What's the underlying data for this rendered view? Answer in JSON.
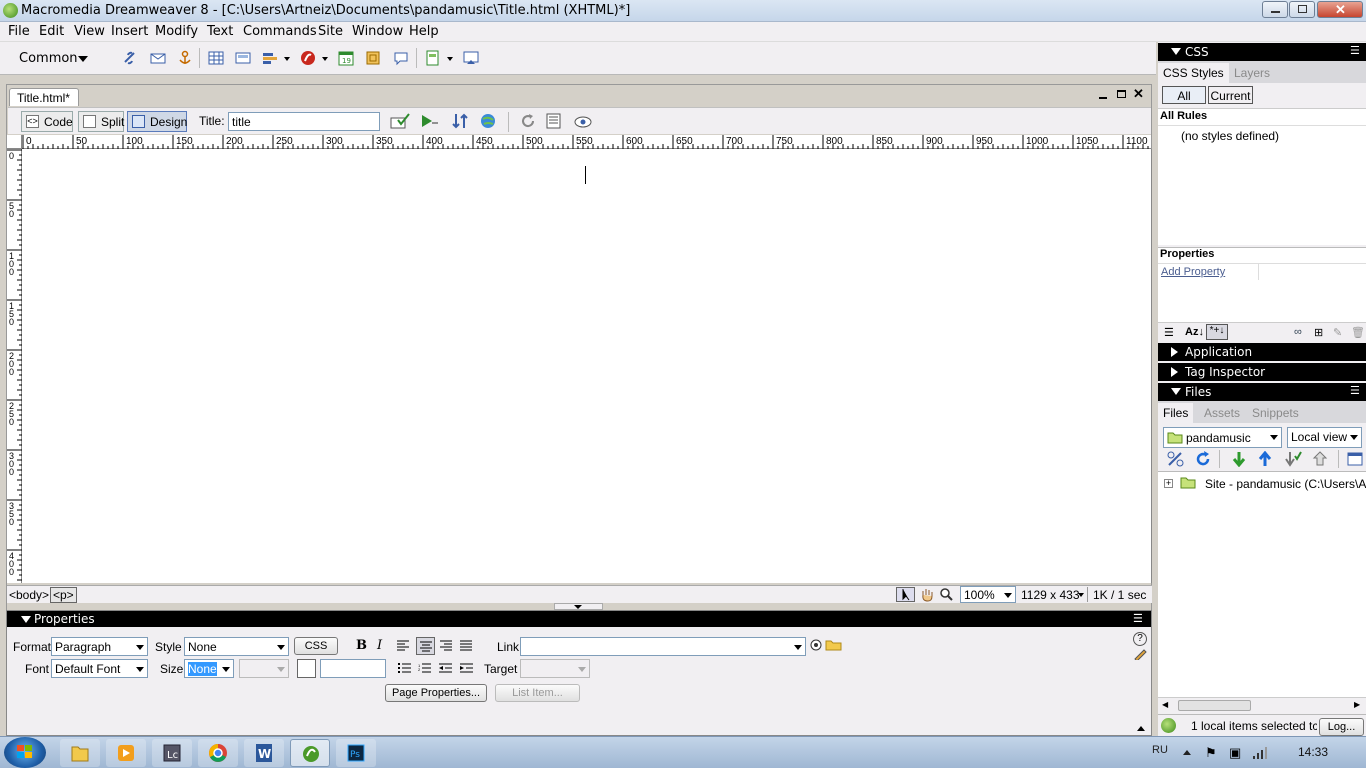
{
  "window": {
    "title": "Macromedia Dreamweaver 8 - [C:\\Users\\Artneiz\\Documents\\pandamusic\\Title.html (XHTML)*]"
  },
  "menu": [
    "File",
    "Edit",
    "View",
    "Insert",
    "Modify",
    "Text",
    "Commands",
    "Site",
    "Window",
    "Help"
  ],
  "insert_bar": {
    "category": "Common",
    "icons": [
      "hyperlink-icon",
      "email-link-icon",
      "named-anchor-icon",
      "table-icon",
      "div-icon",
      "images-icon",
      "media-icon",
      "date-icon",
      "server-side-include-icon",
      "comment-icon",
      "templates-icon",
      "tag-chooser-icon"
    ]
  },
  "document": {
    "tab_label": "Title.html*",
    "views": [
      "Code",
      "Split",
      "Design"
    ],
    "title_label": "Title:",
    "title_value": "title",
    "ruler_h": [
      "0",
      "50",
      "100",
      "150",
      "200",
      "250",
      "300",
      "350",
      "400",
      "450",
      "500",
      "550",
      "600",
      "650",
      "700",
      "750",
      "800",
      "850",
      "900",
      "950",
      "1000",
      "1050",
      "1100"
    ],
    "ruler_v": [
      "0",
      "5\n0",
      "1\n0\n0",
      "1\n5\n0",
      "2\n0\n0",
      "2\n5\n0",
      "3\n0\n0",
      "3\n5\n0",
      "4\n0\n0"
    ]
  },
  "status_bar": {
    "tags": [
      "<body>",
      "<p>"
    ],
    "zoom": "100%",
    "size": "1129 x 433",
    "download": "1K / 1 sec"
  },
  "properties": {
    "title": "Properties",
    "format_label": "Format",
    "format_value": "Paragraph",
    "style_label": "Style",
    "style_value": "None",
    "css_button": "CSS",
    "link_label": "Link",
    "link_value": "",
    "font_label": "Font",
    "font_value": "Default Font",
    "size_label": "Size",
    "size_value": "None",
    "target_label": "Target",
    "page_properties_button": "Page Properties...",
    "list_item_button": "List Item..."
  },
  "css_panel": {
    "title": "CSS",
    "tabs": [
      "CSS Styles",
      "Layers"
    ],
    "modes": [
      "All",
      "Current"
    ],
    "all_rules_label": "All Rules",
    "no_styles": "(no styles defined)",
    "properties_label": "Properties",
    "add_property": "Add Property"
  },
  "application_panel": {
    "title": "Application"
  },
  "tag_inspector_panel": {
    "title": "Tag Inspector"
  },
  "files_panel": {
    "title": "Files",
    "tabs": [
      "Files",
      "Assets",
      "Snippets"
    ],
    "site": "pandamusic",
    "view": "Local view",
    "tree_item": "Site - pandamusic (C:\\Users\\Artn",
    "status": "1 local items selected tc",
    "log_button": "Log..."
  },
  "taskbar": {
    "lang": "RU",
    "time": "14:33"
  },
  "colors": {
    "panel_header": "#000000",
    "panel_bg": "#f1eff2",
    "canvas": "#ffffff",
    "link": "#4a5d8f"
  }
}
